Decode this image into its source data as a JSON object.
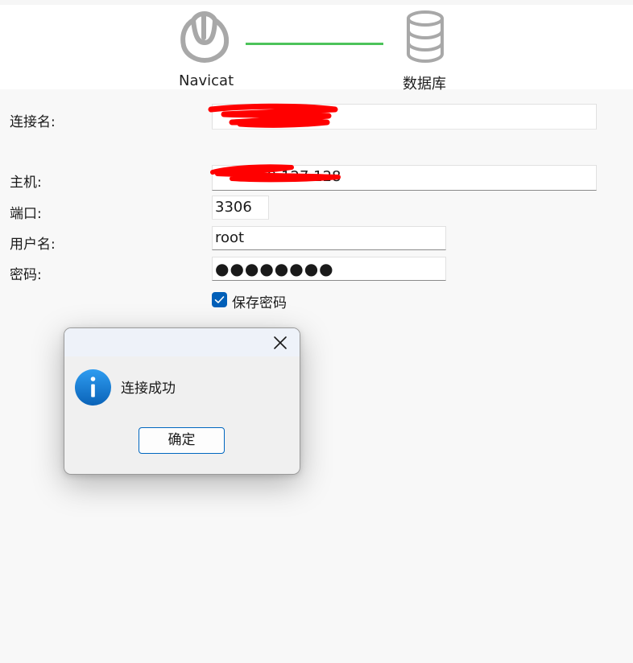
{
  "header": {
    "left_label": "Navicat",
    "right_label": "数据库",
    "connector_color": "#4cc35a"
  },
  "form": {
    "connection_name": {
      "label": "连接名:",
      "value": ""
    },
    "host": {
      "label": "主机:",
      "value": "169.127.128"
    },
    "port": {
      "label": "端口:",
      "value": "3306"
    },
    "username": {
      "label": "用户名:",
      "value": "root"
    },
    "password": {
      "label": "密码:",
      "value": "●●●●●●●●"
    },
    "save_password": {
      "label": "保存密码",
      "checked": true
    }
  },
  "dialog": {
    "message": "连接成功",
    "ok_label": "确定",
    "icon": "info-icon",
    "close_icon": "close-icon"
  },
  "colors": {
    "accent": "#005fb8",
    "redaction": "#ff0000"
  }
}
